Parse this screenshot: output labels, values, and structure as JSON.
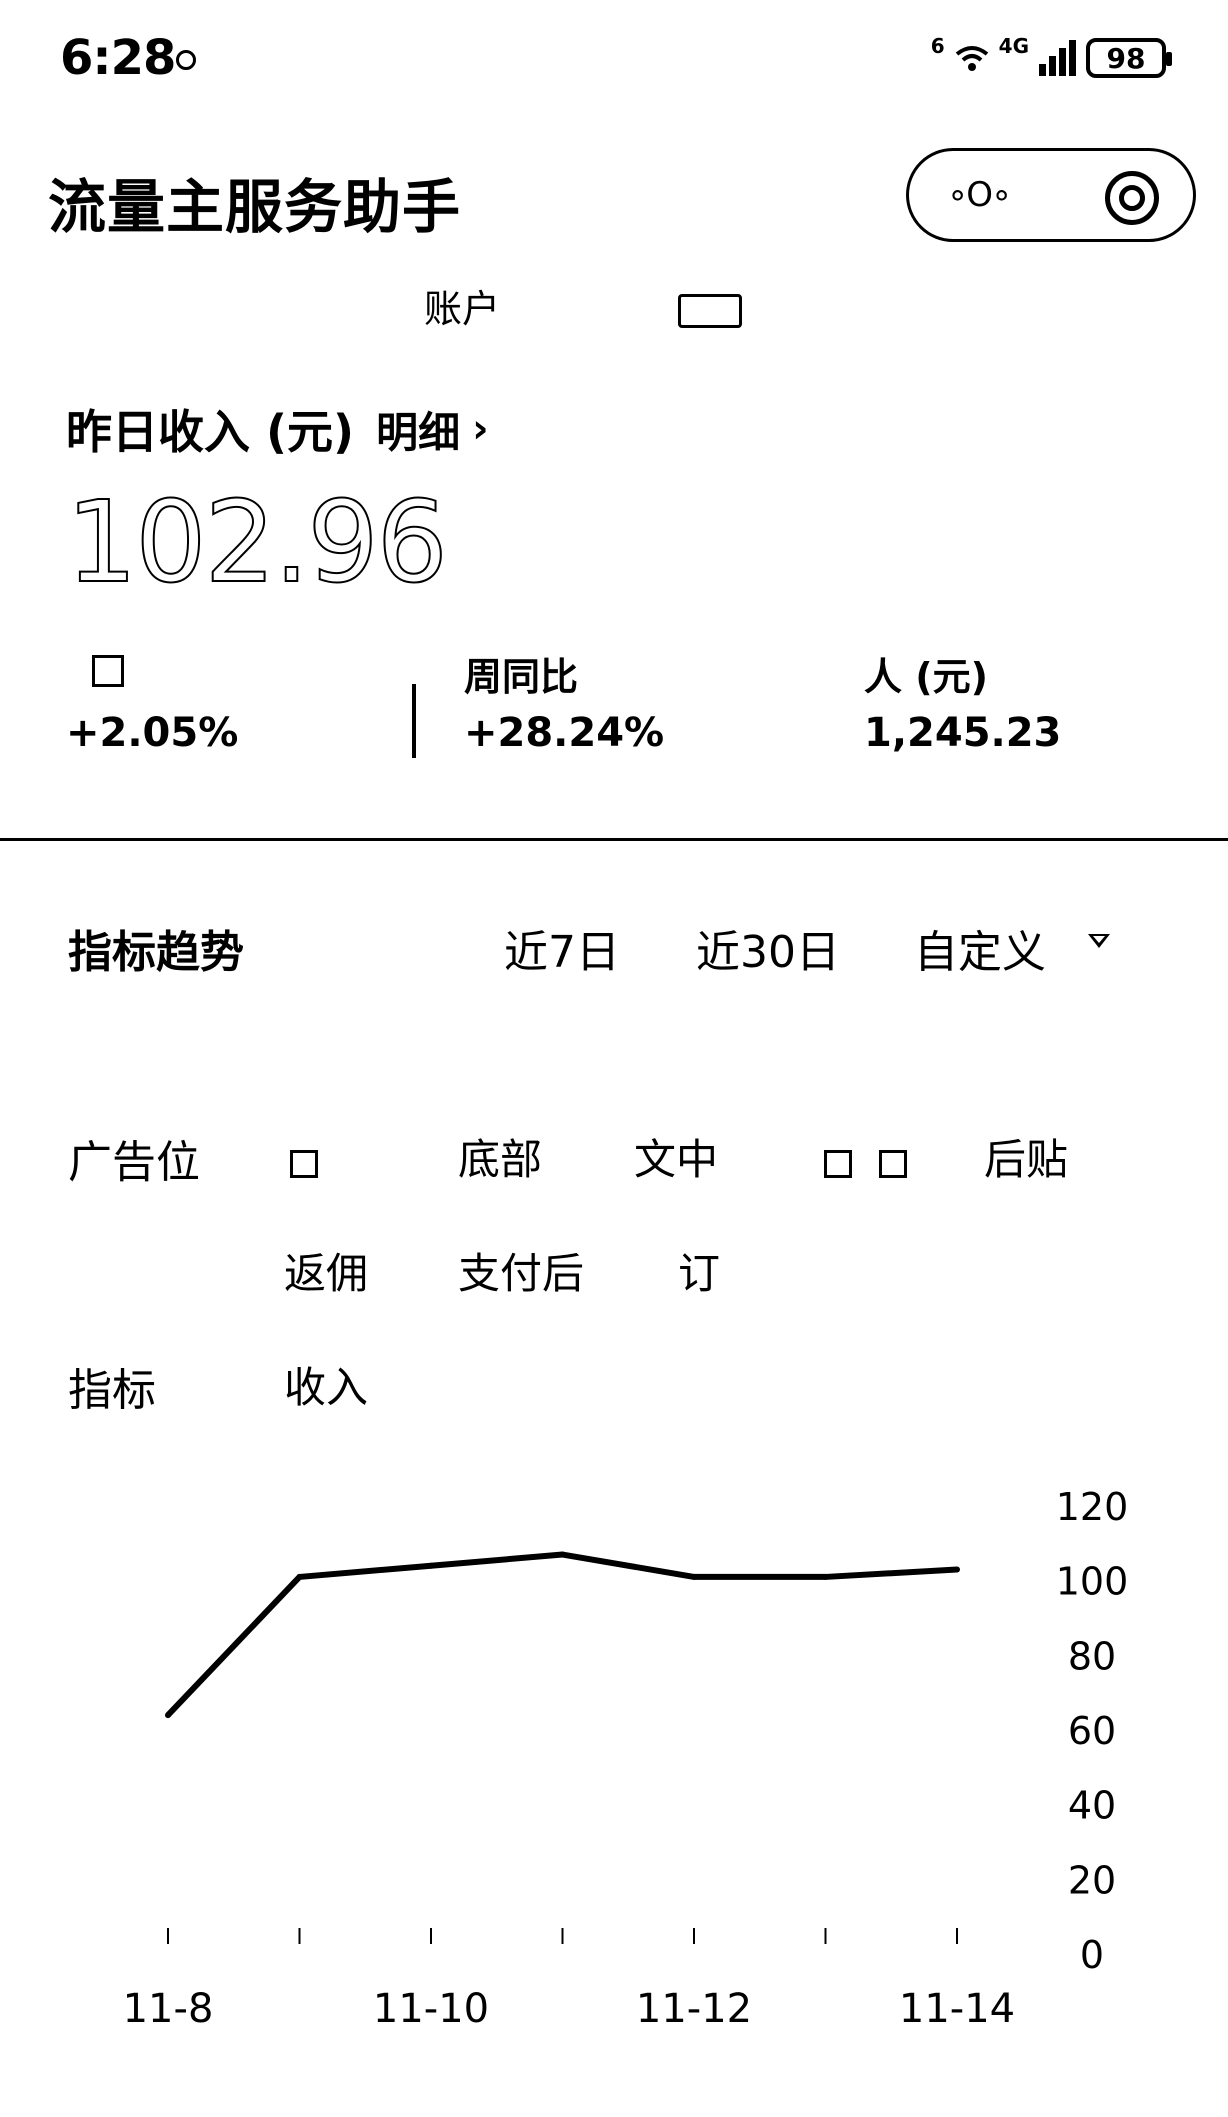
{
  "status_bar": {
    "time": "6:28",
    "wifi_label": "6",
    "network_label": "4G",
    "battery": "98"
  },
  "header": {
    "title": "流量主服务助手",
    "more_glyph": "∘O∘"
  },
  "account": {
    "label": "账户"
  },
  "income": {
    "label": "昨日收入 (元)",
    "detail_label": "明细",
    "chevron": "›",
    "value": "102.96"
  },
  "stats": [
    {
      "label": "",
      "value": "+2.05%"
    },
    {
      "label": "周同比",
      "value": "+28.24%"
    },
    {
      "label": "人 (元)",
      "value": "1,245.23"
    }
  ],
  "trend": {
    "title": "指标趋势",
    "ranges": [
      "近7日",
      "近30日",
      "自定义"
    ]
  },
  "filters": {
    "ad_slot_label": "广告位",
    "ad_slots_row1": [
      "",
      "底部",
      "文中",
      "",
      "后贴"
    ],
    "ad_slots_row2": [
      "返佣",
      "支付后",
      "订"
    ],
    "metric_label": "指标",
    "metric_value": "收入"
  },
  "chart_data": {
    "type": "line",
    "x": [
      "11-8",
      "11-9",
      "11-10",
      "11-11",
      "11-12",
      "11-13",
      "11-14"
    ],
    "x_tick_labels": [
      "11-8",
      "11-10",
      "11-12",
      "11-14"
    ],
    "series": [
      {
        "values": [
          64,
          101,
          104,
          107,
          101,
          101,
          103
        ]
      }
    ],
    "y_ticks": [
      "120",
      "100",
      "80",
      "60",
      "40",
      "20",
      "0"
    ],
    "ylim": [
      0,
      120
    ],
    "y_axis_position": "right",
    "grid": false,
    "line_color": "#000000"
  }
}
